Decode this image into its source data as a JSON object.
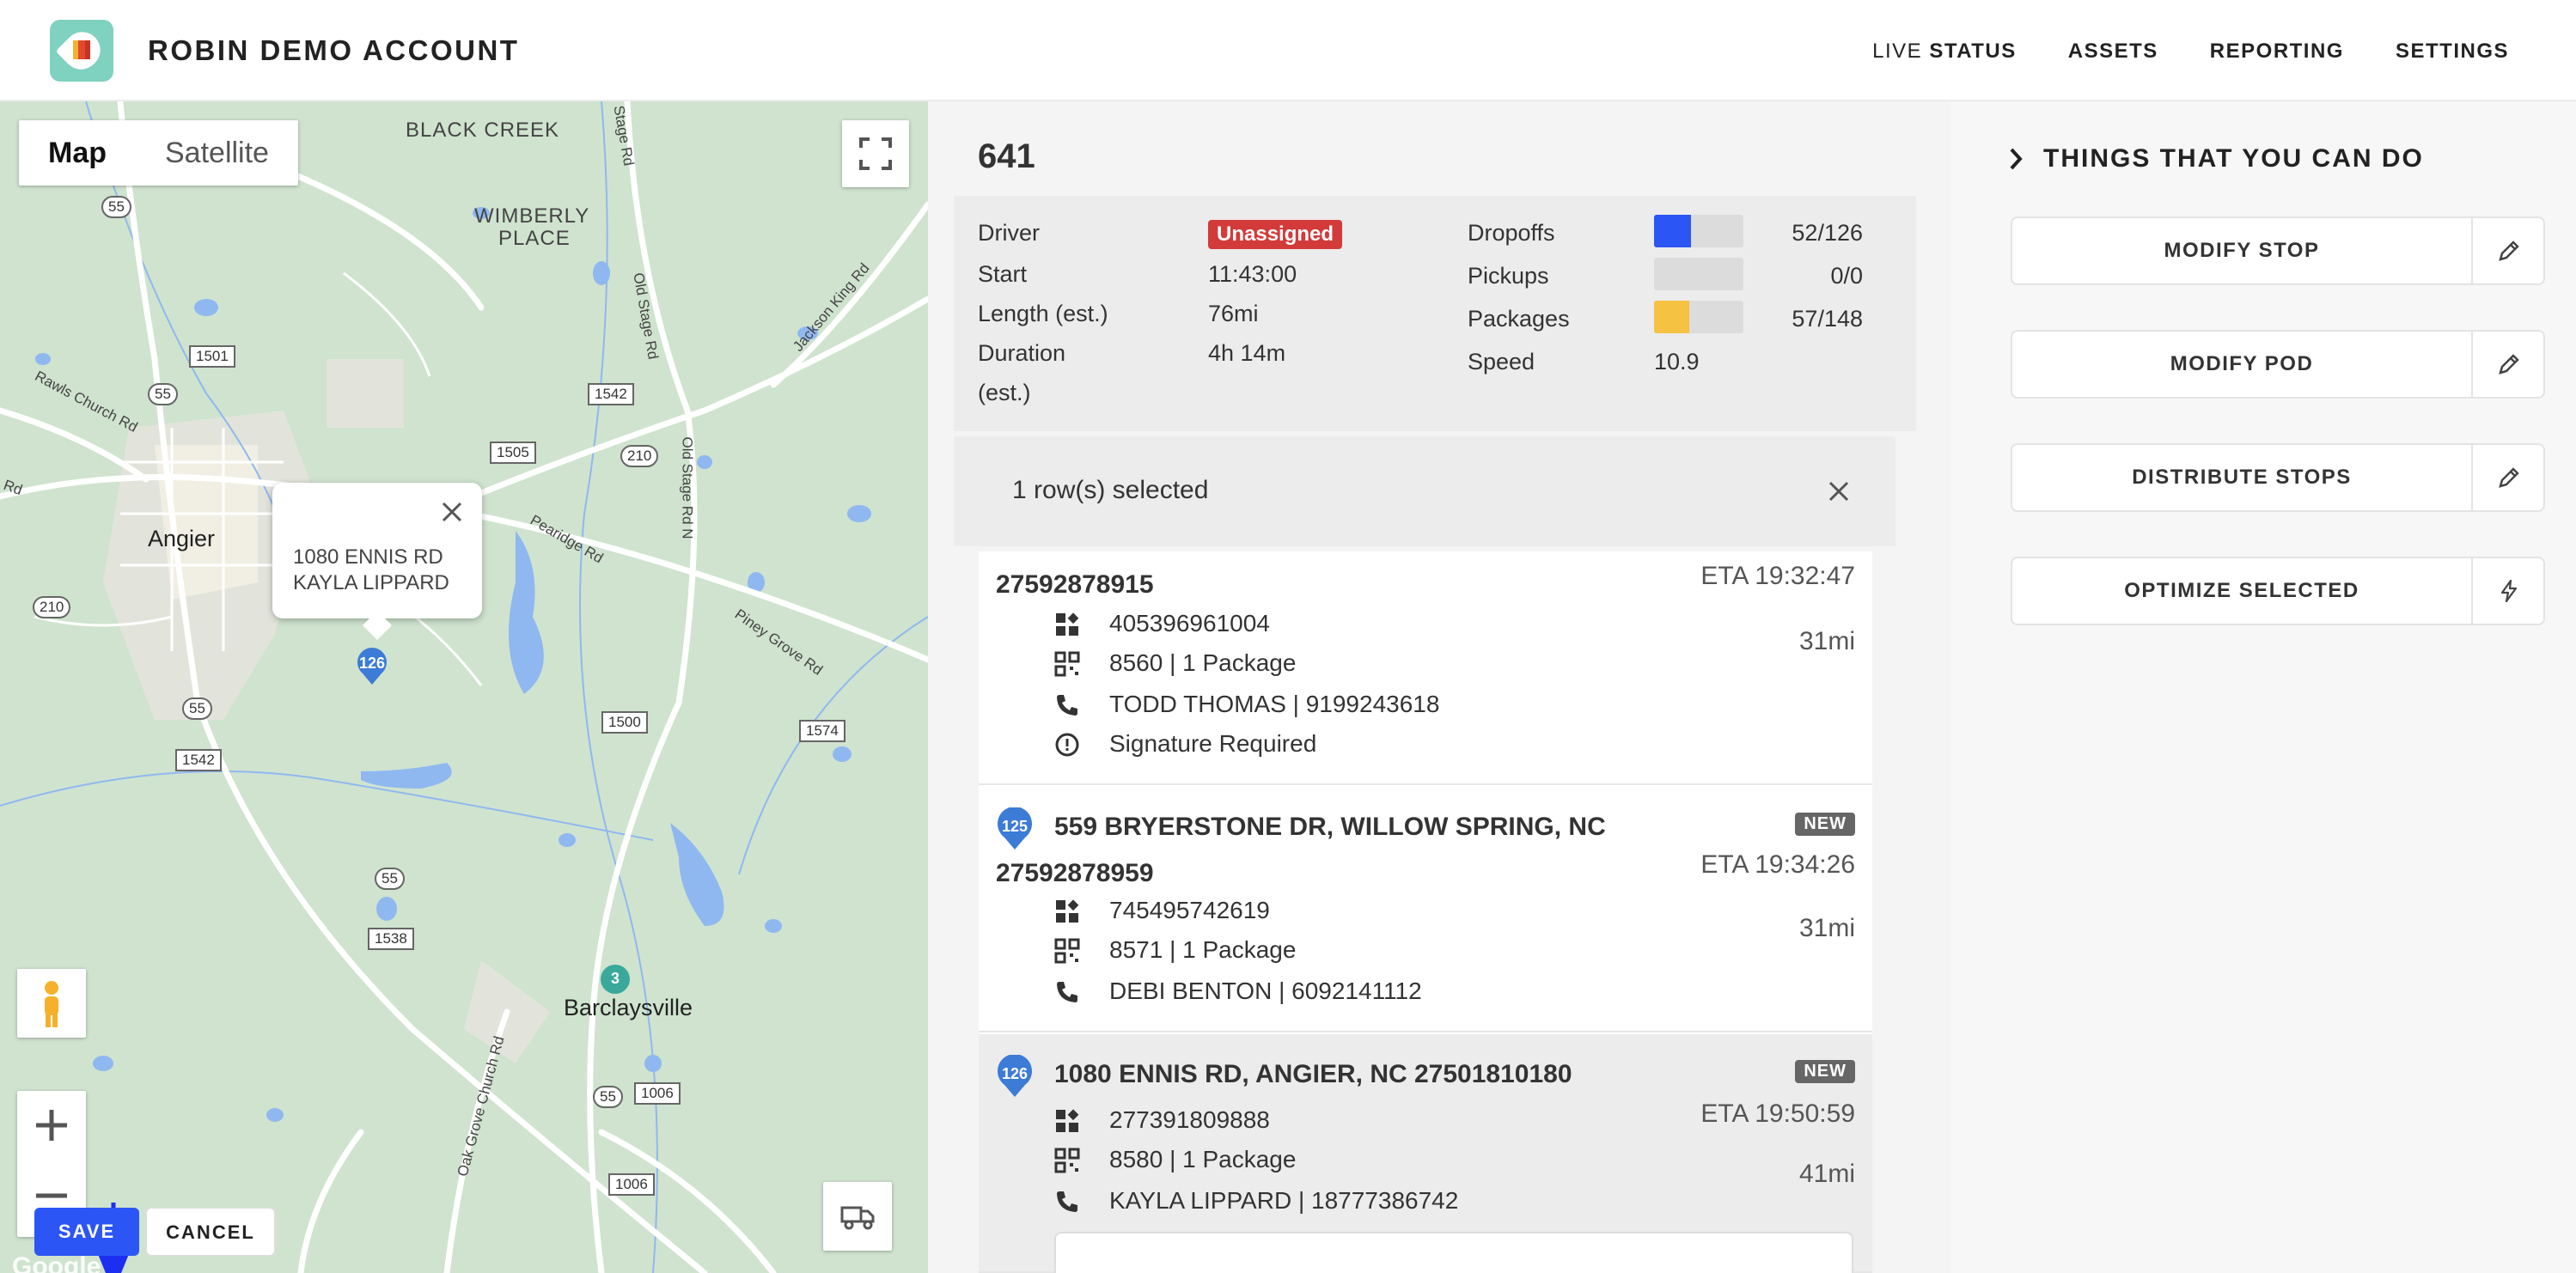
{
  "header": {
    "account_name": "ROBIN DEMO ACCOUNT",
    "nav": {
      "live_light": "LIVE",
      "live_bold": "STATUS",
      "assets": "ASSETS",
      "reporting": "REPORTING",
      "settings": "SETTINGS"
    }
  },
  "map": {
    "type_map": "Map",
    "type_satellite": "Satellite",
    "labels": {
      "black_creek": "BLACK CREEK",
      "wimberly_1": "WIMBERLY",
      "wimberly_2": "PLACE",
      "angier": "Angier",
      "barclaysville": "Barclaysville",
      "google": "Google"
    },
    "roads": {
      "rawls": "Rawls Church Rd",
      "old_stage": "Old Stage Rd",
      "old_stage_n": "Old Stage Rd N",
      "pearidge": "Pearidge Rd",
      "piney": "Piney Grove Rd",
      "jackson": "Jackson King Rd",
      "oak_grove": "Oak Grove Church Rd",
      "stage_top": "Stage Rd",
      "rd_left": "Rd"
    },
    "shields": {
      "s55a": "55",
      "s1501": "1501",
      "s55b": "55",
      "s1542a": "1542",
      "s1505": "1505",
      "s210a": "210",
      "s210b": "210",
      "s55c": "55",
      "s1542b": "1542",
      "s1500": "1500",
      "s1574": "1574",
      "s55d": "55",
      "s1538": "1538",
      "s55e": "55",
      "s1006a": "1006",
      "s1006b": "1006"
    },
    "popup": {
      "line1": "1080 ENNIS RD",
      "line2": "KAYLA LIPPARD"
    },
    "pin_main": "126",
    "pin_green": "3",
    "save_label": "SAVE",
    "cancel_label": "CANCEL"
  },
  "route": {
    "title": "641",
    "stats": {
      "driver_label": "Driver",
      "driver_value": "Unassigned",
      "start_label": "Start",
      "start_value": "11:43:00",
      "length_label": "Length (est.)",
      "length_value": "76mi",
      "duration_label_1": "Duration",
      "duration_label_2": "(est.)",
      "duration_value": "4h 14m",
      "dropoffs_label": "Dropoffs",
      "dropoffs_value": "52/126",
      "dropoffs_fraction": 0.41,
      "pickups_label": "Pickups",
      "pickups_value": "0/0",
      "pickups_fraction": 0,
      "packages_label": "Packages",
      "packages_value": "57/148",
      "packages_fraction": 0.39,
      "speed_label": "Speed",
      "speed_value": "10.9"
    },
    "selection": {
      "text": "1 row(s) selected"
    },
    "stops": [
      {
        "id": "27592878915",
        "eta": "ETA 19:32:47",
        "distance": "31mi",
        "barcode": "405396961004",
        "package": "8560 | 1 Package",
        "contact": "TODD THOMAS | 9199243618",
        "note": "Signature Required"
      },
      {
        "number": "125",
        "address": "559 BRYERSTONE DR, WILLOW SPRING, NC",
        "badge": "NEW",
        "id": "27592878959",
        "eta": "ETA 19:34:26",
        "distance": "31mi",
        "barcode": "745495742619",
        "package": "8571 | 1 Package",
        "contact": "DEBI BENTON | 6092141112"
      },
      {
        "number": "126",
        "address": "1080 ENNIS RD, ANGIER, NC 27501810180",
        "badge": "NEW",
        "eta": "ETA 19:50:59",
        "distance": "41mi",
        "barcode": "277391809888",
        "package": "8580 | 1 Package",
        "contact": "KAYLA LIPPARD | 18777386742"
      }
    ]
  },
  "actions": {
    "title": "THINGS THAT YOU CAN DO",
    "items": [
      {
        "label": "MODIFY STOP",
        "icon": "pencil-icon"
      },
      {
        "label": "MODIFY POD",
        "icon": "pencil-icon"
      },
      {
        "label": "DISTRIBUTE STOPS",
        "icon": "pencil-icon"
      },
      {
        "label": "OPTIMIZE SELECTED",
        "icon": "lightning-icon"
      }
    ]
  },
  "colors": {
    "accent_blue": "#2c55f5",
    "pin_blue": "#3c7bd6",
    "danger": "#d33a3a",
    "packages_bar": "#f5c242",
    "map_green": "#cfe3cf",
    "water_blue": "#8fb8f0"
  }
}
